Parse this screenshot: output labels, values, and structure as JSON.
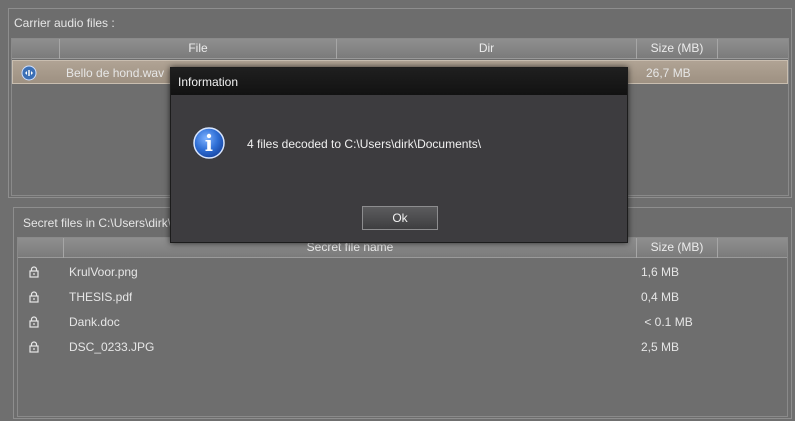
{
  "carrier": {
    "title": "Carrier audio files :",
    "columns": [
      "File",
      "Dir",
      "Size (MB)"
    ],
    "rows": [
      {
        "file": "Bello de hond.wav",
        "dir": "",
        "size": "26,7 MB",
        "icon": "audio-file-icon"
      }
    ]
  },
  "secret": {
    "title": "Secret files in C:\\Users\\dirk\\",
    "columns": [
      "Secret file name",
      "Size (MB)"
    ],
    "rows": [
      {
        "name": "KrulVoor.png",
        "size": "1,6 MB",
        "icon": "lock-icon"
      },
      {
        "name": "THESIS.pdf",
        "size": "0,4 MB",
        "icon": "lock-icon"
      },
      {
        "name": "Dank.doc",
        "size": " < 0.1 MB",
        "icon": "lock-icon"
      },
      {
        "name": "DSC_0233.JPG",
        "size": "2,5 MB",
        "icon": "lock-icon"
      }
    ]
  },
  "dialog": {
    "title": "Information",
    "message": "4 files decoded to C:\\Users\\dirk\\Documents\\",
    "ok_label": "Ok",
    "icon": "info-icon"
  },
  "colors": {
    "background": "#6f6f6f",
    "selected_row": "#a89b8c",
    "dialog_bg": "#3d3c3f",
    "info_blue": "#2f6fd6"
  }
}
